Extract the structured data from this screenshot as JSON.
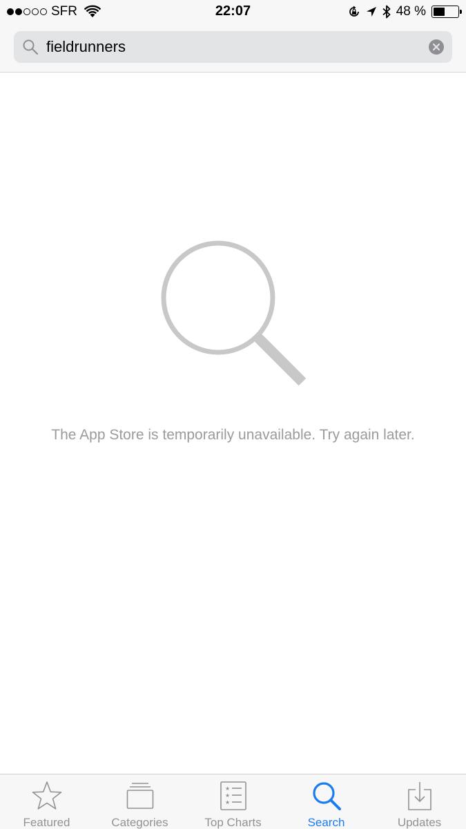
{
  "status_bar": {
    "signal_filled": 2,
    "signal_total": 5,
    "carrier": "SFR",
    "time": "22:07",
    "battery_percent": "48 %",
    "battery_level": 0.48,
    "icons": [
      "wifi-icon",
      "orientation-lock-icon",
      "location-icon",
      "bluetooth-icon",
      "battery-icon"
    ]
  },
  "search": {
    "query": "fieldrunners",
    "search_icon": "magnifying-glass-icon",
    "clear_icon": "clear-icon"
  },
  "empty_state": {
    "icon": "magnifying-glass-icon",
    "message": "The App Store is temporarily unavailable. Try again later."
  },
  "tab_bar": {
    "tabs": [
      {
        "label": "Featured",
        "icon": "star-icon",
        "active": false
      },
      {
        "label": "Categories",
        "icon": "categories-icon",
        "active": false
      },
      {
        "label": "Top Charts",
        "icon": "top-charts-icon",
        "active": false
      },
      {
        "label": "Search",
        "icon": "search-icon",
        "active": true
      },
      {
        "label": "Updates",
        "icon": "updates-icon",
        "active": false
      }
    ]
  },
  "colors": {
    "accent": "#1a7cf0",
    "inactive": "#929292",
    "message": "#9b9b9b",
    "bar_background": "#f7f7f7"
  }
}
